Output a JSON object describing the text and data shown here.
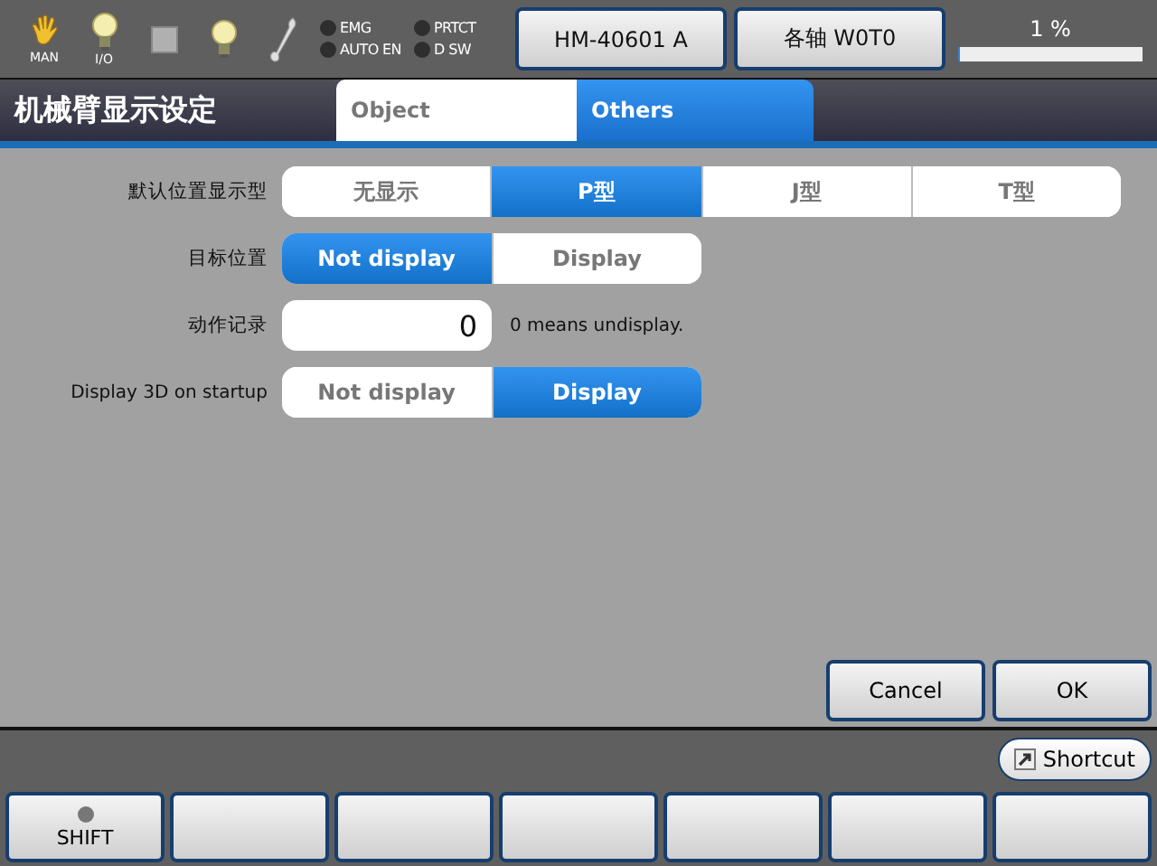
{
  "toolbar": {
    "icons": [
      {
        "kind": "hand",
        "label": "MAN"
      },
      {
        "kind": "bulb",
        "label": "I/O"
      },
      {
        "kind": "square"
      },
      {
        "kind": "bulb"
      },
      {
        "kind": "wrench"
      }
    ],
    "indicators": [
      {
        "label": "EMG",
        "on": false
      },
      {
        "label": "PRTCT",
        "on": false
      },
      {
        "label": "AUTO EN",
        "on": false
      },
      {
        "label": "D SW",
        "on": false
      }
    ],
    "buttons": [
      "HM-40601 A",
      "各轴 W0T0"
    ],
    "progress": {
      "reading": "1 %",
      "level": 0.01
    }
  },
  "window": {
    "title": "机械臂显示设定"
  },
  "tabs": [
    {
      "label": "Object",
      "selected": false
    },
    {
      "label": "Others",
      "selected": true
    }
  ],
  "settings": [
    {
      "label": "默认位置显示型",
      "kind": "segments",
      "options": [
        {
          "label": "无显示",
          "selected": false
        },
        {
          "label": "P型",
          "selected": true
        },
        {
          "label": "J型",
          "selected": false
        },
        {
          "label": "T型",
          "selected": false
        }
      ]
    },
    {
      "label": "目标位置",
      "kind": "segments",
      "options": [
        {
          "label": "Not display",
          "selected": true
        },
        {
          "label": "Display",
          "selected": false
        }
      ]
    },
    {
      "label": "动作记录",
      "kind": "number",
      "value": "0",
      "note": "0 means undisplay."
    },
    {
      "label": "Display 3D on startup",
      "kind": "segments",
      "options": [
        {
          "label": "Not display",
          "selected": false
        },
        {
          "label": "Display",
          "selected": true
        }
      ]
    }
  ],
  "dialog_buttons": [
    "Cancel",
    "OK"
  ],
  "shortcut": {
    "label": "Shortcut"
  },
  "function_keys": [
    {
      "kind": "lamp",
      "label": "SHIFT",
      "on": false
    },
    {
      "kind": "plain"
    },
    {
      "kind": "plain"
    },
    {
      "kind": "plain"
    },
    {
      "kind": "plain"
    },
    {
      "kind": "plain"
    },
    {
      "kind": "plain"
    }
  ]
}
